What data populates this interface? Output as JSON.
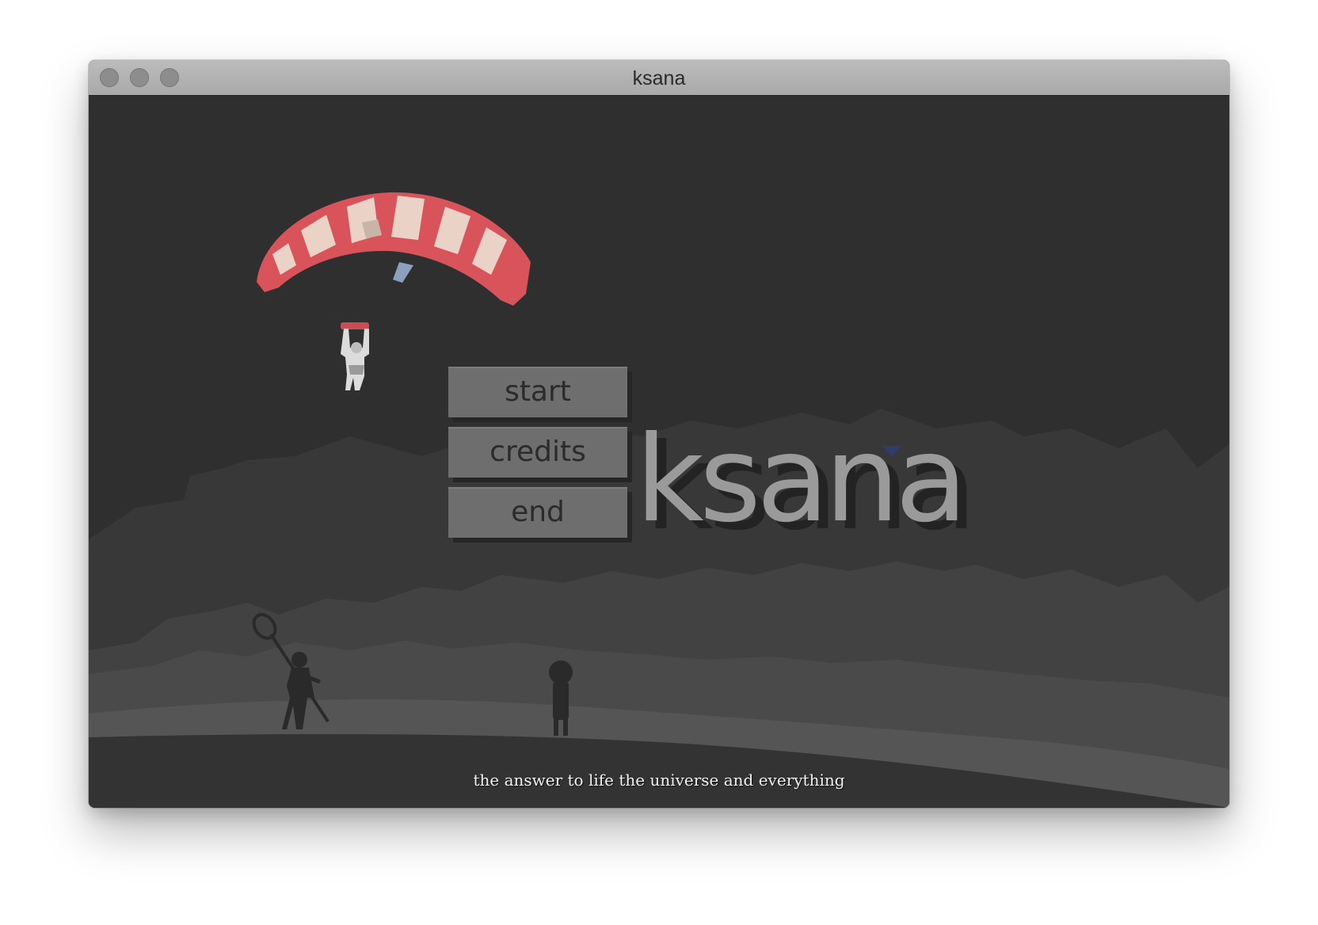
{
  "window": {
    "title": "ksana"
  },
  "menu": {
    "start_label": "start",
    "credits_label": "credits",
    "end_label": "end"
  },
  "logo": {
    "text": "ksana"
  },
  "tagline": "the answer to life the universe and everything",
  "colors": {
    "background": "#2f2f2f",
    "button": "#6e6e6e",
    "button_text": "#2b2b2b",
    "logo": "#9a9a9a",
    "parachute_red": "#d9545a",
    "parachute_cream": "#ead3c6"
  }
}
